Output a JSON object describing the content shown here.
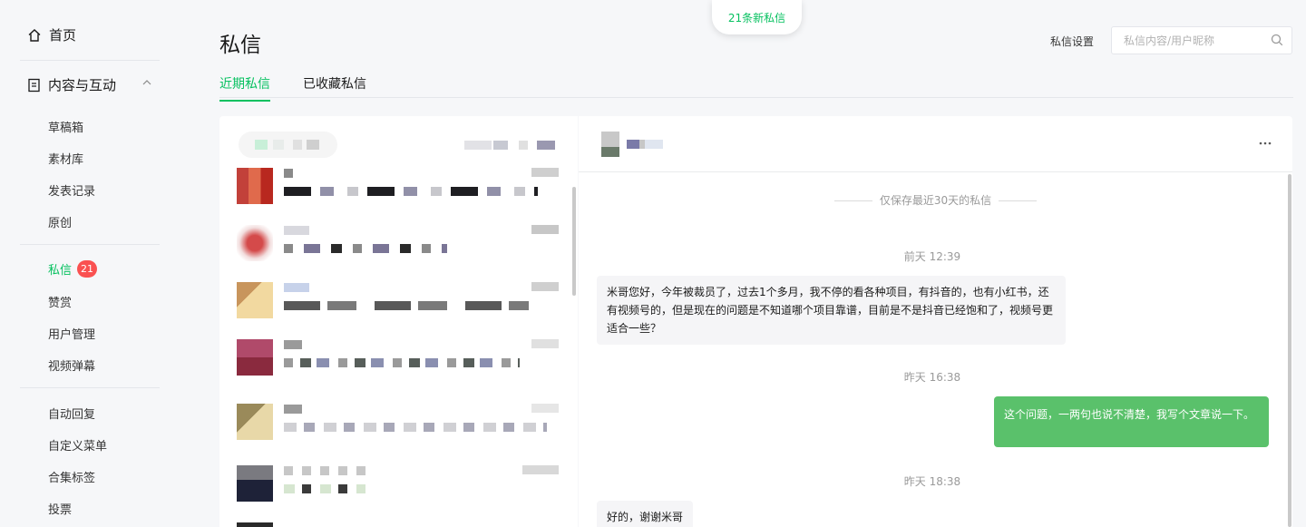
{
  "sidebar": {
    "home": "首页",
    "group": "内容与互动",
    "items": {
      "drafts": "草稿箱",
      "assets": "素材库",
      "publish_records": "发表记录",
      "original": "原创",
      "messages": "私信",
      "messages_badge": "21",
      "appreciation": "赞赏",
      "user_management": "用户管理",
      "danmaku": "视频弹幕",
      "auto_reply": "自动回复",
      "custom_menu": "自定义菜单",
      "collection_tags": "合集标签",
      "vote": "投票"
    }
  },
  "header": {
    "title": "私信",
    "new_messages": "21条新私信",
    "settings": "私信设置",
    "search_placeholder": "私信内容/用户昵称"
  },
  "tabs": {
    "recent": "近期私信",
    "starred": "已收藏私信"
  },
  "chat": {
    "notice": "仅保存最近30天的私信",
    "messages": [
      {
        "type": "time",
        "text": "前天 12:39"
      },
      {
        "type": "in",
        "text": "米哥您好，今年被裁员了，过去1个多月，我不停的看各种项目，有抖音的，也有小红书，还有视频号的，但是现在的问题是不知道哪个项目靠谱，目前是不是抖音已经饱和了，视频号更适合一些？"
      },
      {
        "type": "time",
        "text": "昨天 16:38"
      },
      {
        "type": "out",
        "text": "这个问题，一两句也说不清楚，我写个文章说一下。"
      },
      {
        "type": "time",
        "text": "昨天 18:38"
      },
      {
        "type": "in",
        "text": "好的，谢谢米哥"
      }
    ]
  },
  "colors": {
    "accent": "#07c160",
    "badge": "#fa5151",
    "outgoing_bubble": "#5ac16b"
  }
}
